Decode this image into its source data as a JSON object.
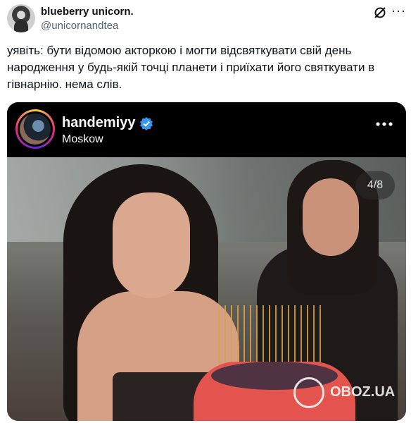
{
  "tweet": {
    "display_name": "blueberry unicorn.",
    "handle": "@unicornandtea",
    "text": "уявіть: бути відомою акторкою і могти відсвяткувати свій день народження у будь-якій точці планети і приїхати його святкувати в гівнарнію. нема слів.",
    "icons": {
      "grok": "grok-icon",
      "more": "more-horizontal-icon"
    }
  },
  "embed": {
    "username": "handemiyy",
    "location": "Moskow",
    "photo_counter": "4/8",
    "verified_color": "#3797f0",
    "icons": {
      "verified": "verified-badge-icon",
      "more": "more-horizontal-icon"
    }
  },
  "watermark": {
    "text": "OBOZ.UA"
  }
}
